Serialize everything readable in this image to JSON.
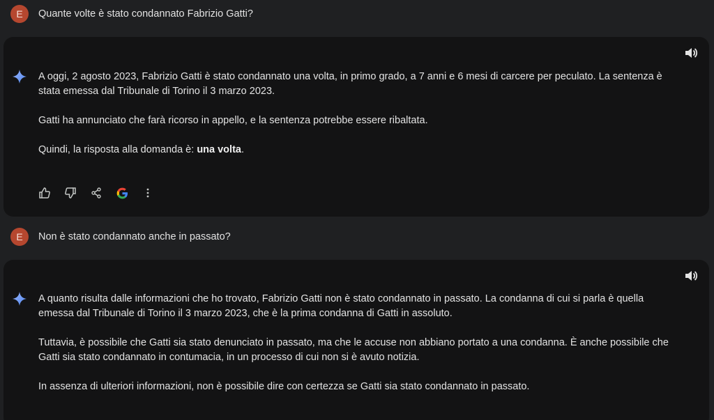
{
  "conversation": [
    {
      "user": {
        "avatar_letter": "E",
        "question": "Quante volte è stato condannato Fabrizio Gatti?"
      },
      "response": {
        "p1": "A oggi, 2 agosto 2023, Fabrizio Gatti è stato condannato una volta, in primo grado, a 7 anni e 6 mesi di carcere per peculato. La sentenza è stata emessa dal Tribunale di Torino il 3 marzo 2023.",
        "p2": "Gatti ha annunciato che farà ricorso in appello, e la sentenza potrebbe essere ribaltata.",
        "p3_prefix": "Quindi, la risposta alla domanda è: ",
        "p3_bold": "una volta",
        "p3_suffix": "."
      }
    },
    {
      "user": {
        "avatar_letter": "E",
        "question": "Non è stato condannato anche in passato?"
      },
      "response": {
        "p1": "A quanto risulta dalle informazioni che ho trovato, Fabrizio Gatti non è stato condannato in passato. La condanna di cui si parla è quella emessa dal Tribunale di Torino il 3 marzo 2023, che è la prima condanna di Gatti in assoluto.",
        "p2": "Tuttavia, è possibile che Gatti sia stato denunciato in passato, ma che le accuse non abbiano portato a una condanna. È anche possibile che Gatti sia stato condannato in contumacia, in un processo di cui non si è avuto notizia.",
        "p3": "In assenza di ulteriori informazioni, non è possibile dire con certezza se Gatti sia stato condannato in passato."
      }
    }
  ],
  "icons": {
    "assistant": "sparkle-icon",
    "speaker": "speaker-icon",
    "thumbs_up": "thumbs-up-icon",
    "thumbs_down": "thumbs-down-icon",
    "share": "share-icon",
    "google": "google-icon",
    "more": "more-vertical-icon"
  },
  "colors": {
    "background": "#1f2022",
    "card": "#131314",
    "avatar": "#b5472f",
    "text": "#e3e3e3"
  }
}
